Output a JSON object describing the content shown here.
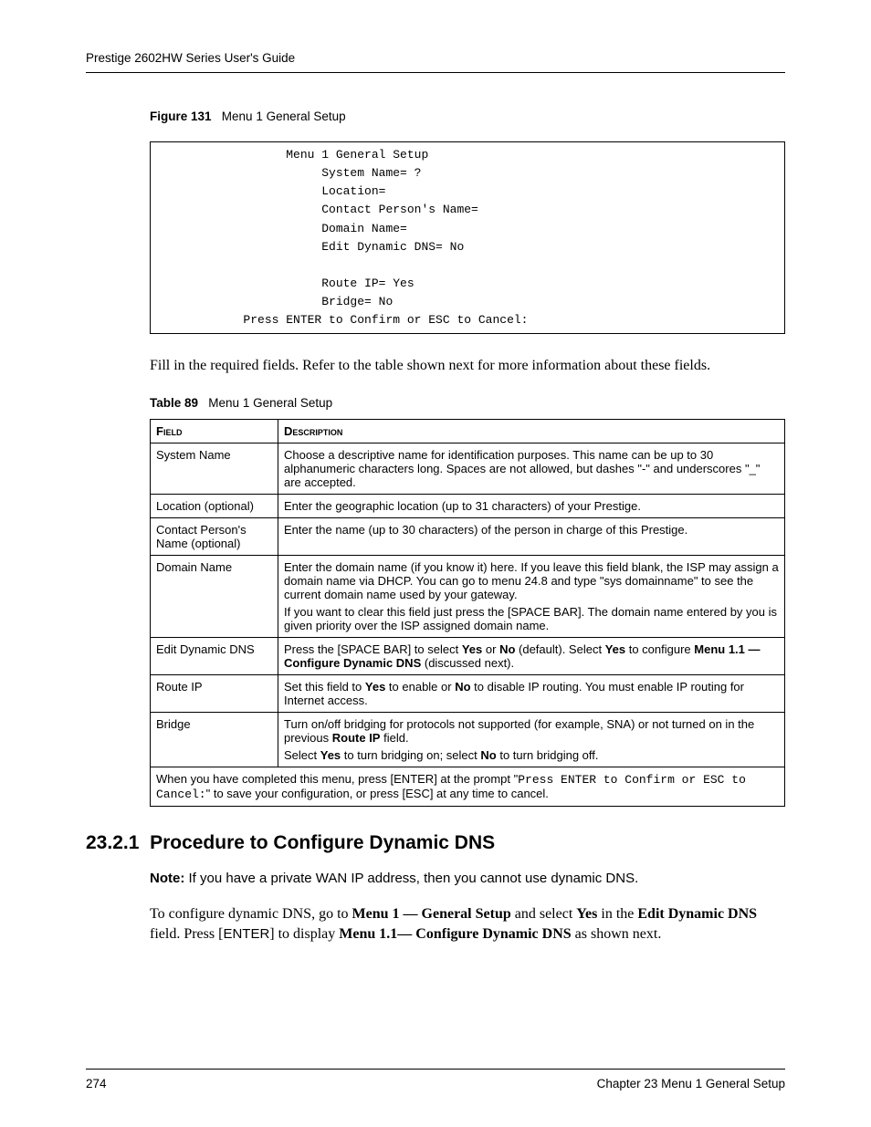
{
  "header": "Prestige 2602HW Series User's Guide",
  "figure": {
    "label": "Figure 131",
    "title": "Menu 1 General Setup"
  },
  "terminal": "                   Menu 1 General Setup\n                        System Name= ?\n                        Location=\n                        Contact Person's Name=\n                        Domain Name=\n                        Edit Dynamic DNS= No\n\n                        Route IP= Yes\n                        Bridge= No\n             Press ENTER to Confirm or ESC to Cancel:",
  "body1": "Fill in the required fields. Refer to the table shown next for more information about these fields.",
  "table_caption": {
    "label": "Table 89",
    "title": "Menu 1 General Setup"
  },
  "table": {
    "head_field": "Field",
    "head_desc": "Description",
    "rows": [
      {
        "field": "System Name",
        "desc": [
          {
            "t": "Choose a descriptive name for identification purposes.  This name can be up to 30 alphanumeric characters long.  Spaces are not allowed, but dashes \"-\" and underscores \"_\" are accepted."
          }
        ]
      },
      {
        "field": "Location (optional)",
        "desc": [
          {
            "t": "Enter the geographic location (up to 31 characters) of your Prestige."
          }
        ]
      },
      {
        "field": "Contact Person's Name (optional)",
        "desc": [
          {
            "t": "Enter the name (up to 30 characters) of the person in charge of this Prestige."
          }
        ]
      },
      {
        "field": "Domain Name",
        "desc": [
          {
            "t": "Enter the domain name (if you know it) here. If you leave this field blank, the ISP may assign a domain name via DHCP. You can go to menu 24.8 and type \"sys domainname\" to see the current domain name used by your gateway."
          },
          {
            "t": "If you want to clear this field just press the [SPACE BAR]. The domain name entered by you is given priority over the ISP assigned domain name."
          }
        ]
      },
      {
        "field": "Edit Dynamic DNS",
        "desc_html": "Press the [SPACE BAR] to select <b>Yes</b> or <b>No</b> (default). Select <b>Yes</b> to configure <b>Menu 1.1 — Configure Dynamic DNS</b> (discussed next)."
      },
      {
        "field": "Route IP",
        "desc_html": "Set this field to <b>Yes</b> to enable or <b>No</b> to disable IP routing.  You must enable IP routing for Internet access."
      },
      {
        "field": "Bridge",
        "desc_html": "<div class='p'>Turn on/off bridging for protocols not supported (for example, SNA) or not turned on in the previous <b>Route IP</b> field.</div><div class='p'>Select <b>Yes</b> to turn bridging on; select <b>No</b> to turn bridging off.</div>"
      }
    ],
    "footer_html": "When you have completed this menu, press [ENTER] at the prompt \"<span class='mono'>Press ENTER to Confirm or ESC to Cancel:</span>\" to save your configuration, or press [ESC] at any time to cancel."
  },
  "section": {
    "num": "23.2.1",
    "title": "Procedure to Configure Dynamic DNS"
  },
  "note_label": "Note:",
  "note_text": "If you have a private WAN IP address, then you cannot use dynamic DNS.",
  "body2_html": "To configure dynamic DNS, go to <b>Menu 1 — General Setup</b> and select <b>Yes</b> in the <b>Edit Dynamic DNS</b> field. Press [<span style='font-family:Arial,Helvetica,sans-serif;font-size:15px'>ENTER</span>] to display <b>Menu 1.1— Configure Dynamic DNS</b> as shown next.",
  "footer": {
    "page": "274",
    "chapter": "Chapter 23 Menu 1 General Setup"
  }
}
